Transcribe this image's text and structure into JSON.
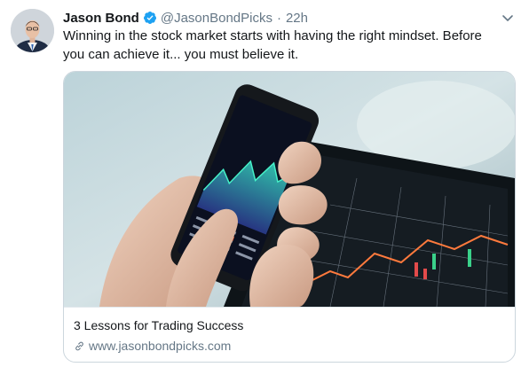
{
  "tweet": {
    "author_name": "Jason Bond",
    "handle": "@JasonBondPicks",
    "separator": "·",
    "time": "22h",
    "text": "Winning in the stock market starts with having the right mindset. Before you can achieve it... you must believe it.",
    "icons": {
      "verified": "verified-badge-icon",
      "caret": "chevron-down-icon",
      "link": "link-icon"
    },
    "colors": {
      "verified_blue": "#1da1f2",
      "secondary_text": "#657786"
    }
  },
  "card": {
    "title": "3 Lessons for Trading Success",
    "domain": "www.jasonbondpicks.com"
  }
}
